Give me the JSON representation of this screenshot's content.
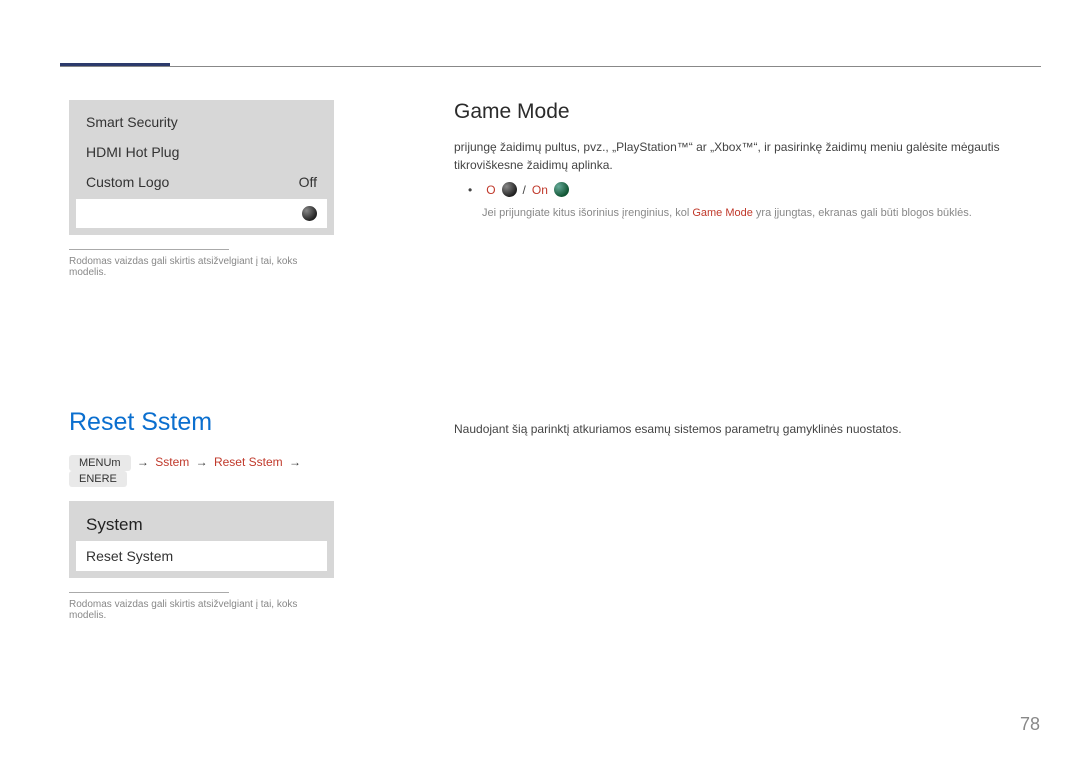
{
  "menu1": {
    "items": {
      "0": "Smart Security",
      "1": "HDMI Hot Plug",
      "2": {
        "label": "Custom Logo",
        "value": "Off"
      }
    }
  },
  "footnote": "Rodomas vaizdas gali skirtis atsižvelgiant į tai, koks modelis.",
  "gamemode": {
    "heading": "Game Mode",
    "para": "prijungę žaidimų pultus, pvz., „PlayStation™“ ar „Xbox™“, ir pasirinkę žaidimų meniu galėsite mėgautis tikroviškesne žaidimų aplinka.",
    "option_off_label": "O",
    "option_on_label": "On",
    "slash": "/",
    "note_pre": "Jei prijungiate kitus išorinius įrenginius, kol ",
    "note_red": "Game Mode",
    "note_post": " yra įjungtas, ekranas gali būti blogos būklės."
  },
  "reset": {
    "heading": "Reset Sstem",
    "bc": {
      "menu": "MENUm",
      "arrow": "→",
      "step1": "Sstem",
      "step2": "Reset Sstem",
      "enter": "ENERE"
    },
    "menu_title": "System",
    "menu_item": "Reset System",
    "body": "Naudojant šią parinktį atkuriamos esamų sistemos parametrų gamyklinės nuostatos."
  },
  "page": "78"
}
